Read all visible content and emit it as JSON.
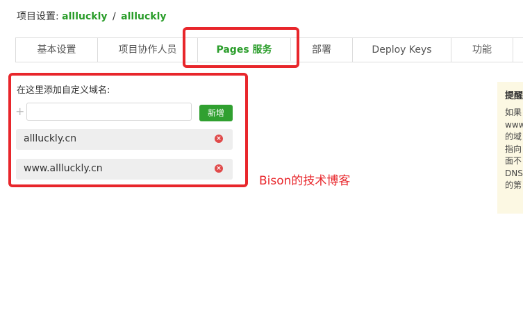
{
  "breadcrumb": {
    "prefix": "项目设置:",
    "owner": "allluckly",
    "separator": "/",
    "repo": "allluckly"
  },
  "tabs": [
    "基本设置",
    "项目协作人员",
    "Pages 服务",
    "部署",
    "Deploy Keys",
    "功能"
  ],
  "domain_form": {
    "label": "在这里添加自定义域名:",
    "plus": "+",
    "input_value": "",
    "add_button": "新增"
  },
  "domains": [
    "allluckly.cn",
    "www.allluckly.cn"
  ],
  "watermark": "Bison的技术博客",
  "tip": {
    "title": "提醒",
    "lines": [
      "如果",
      "www",
      "的域",
      "指向",
      "面不",
      "DNS",
      "的第"
    ]
  },
  "colors": {
    "accent": "#2a9d2a",
    "button": "#30a030",
    "highlight": "#e8262b",
    "tip_bg": "#fcf8e3"
  }
}
